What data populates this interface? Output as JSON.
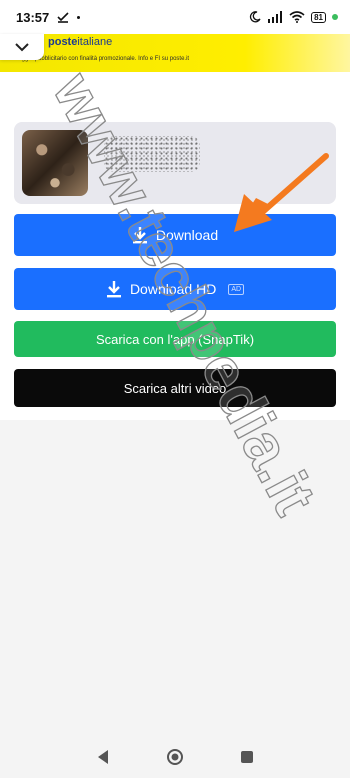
{
  "status_bar": {
    "time": "13:57",
    "battery_level": "81",
    "icons": [
      "download-done-icon",
      "dot-icon",
      "moon-icon",
      "signal-icon",
      "wifi-icon",
      "battery-icon",
      "green-dot-icon"
    ]
  },
  "ad_banner": {
    "logo_bold": "poste",
    "logo_light": "italiane",
    "text": "Messaggio pubblicitario con finalità promozionale. Info e FI su poste.it"
  },
  "buttons": {
    "download_label": "Download",
    "download_hd_label": "Download HD",
    "download_hd_badge": "AD",
    "app_label": "Scarica con l'app (SnapTik)",
    "more_label": "Scarica altri video"
  },
  "watermark": "www.techpedia.it",
  "colors": {
    "download_blue": "#1a6fff",
    "app_green": "#21bb5e",
    "more_black": "#0a0a0a",
    "arrow_orange": "#f47a1f",
    "ad_yellow": "#ffee00"
  }
}
